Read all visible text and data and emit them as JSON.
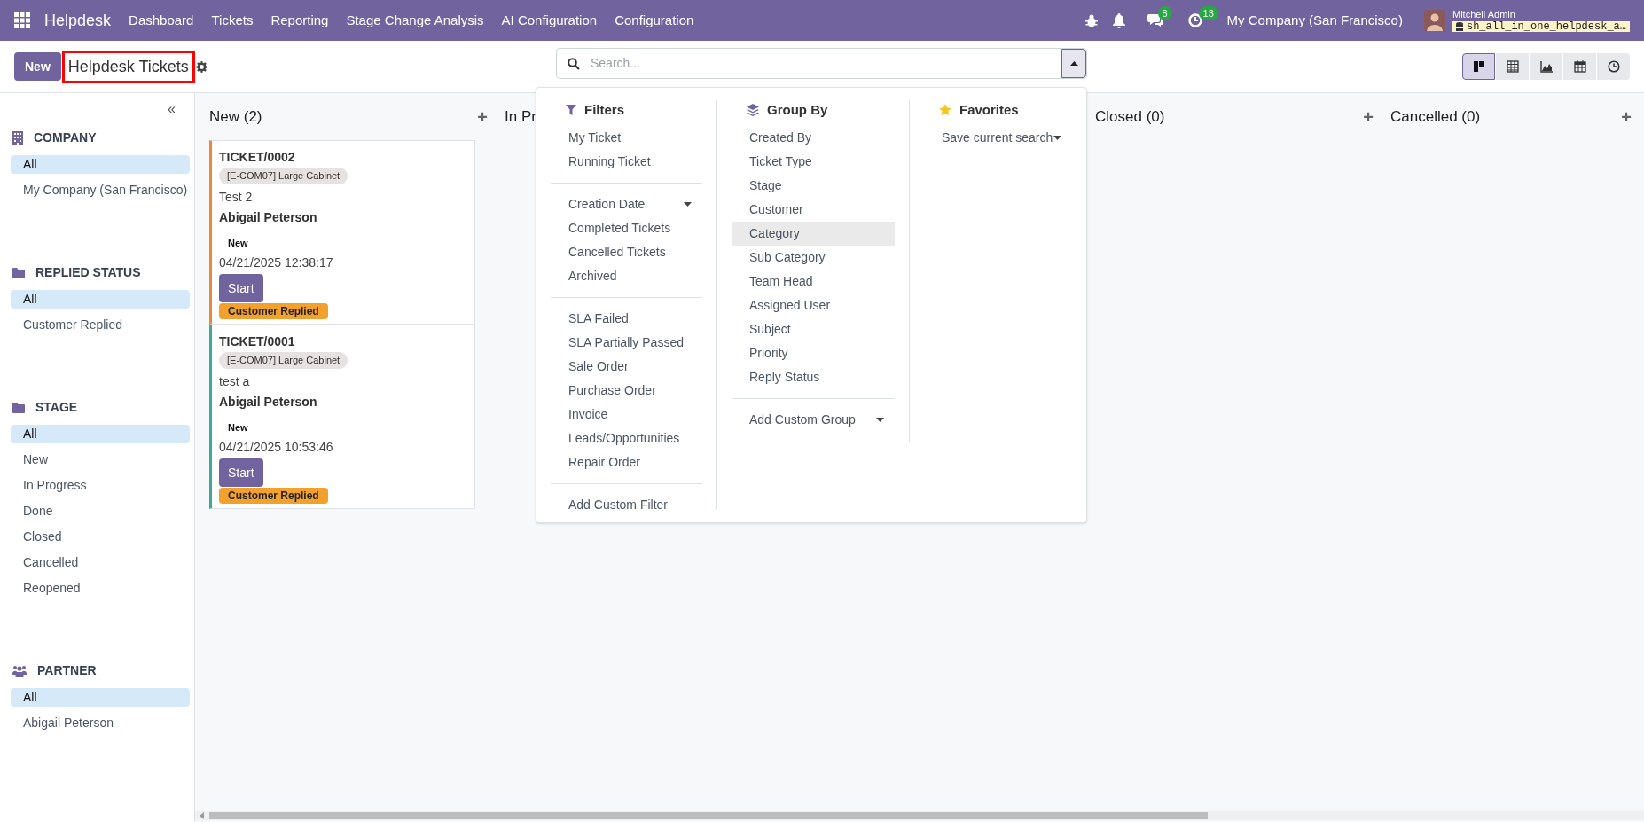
{
  "navbar": {
    "app_name": "Helpdesk",
    "menu": [
      "Dashboard",
      "Tickets",
      "Reporting",
      "Stage Change Analysis",
      "AI Configuration",
      "Configuration"
    ],
    "messages_count": "8",
    "activities_count": "13",
    "company": "My Company (San Francisco)",
    "user_name": "Mitchell Admin",
    "database": "sh_all_in_one_helpdesk_a…"
  },
  "control_panel": {
    "new_button": "New",
    "title": "Helpdesk Tickets",
    "title_highlighted": true,
    "search": {
      "placeholder": "Search..."
    },
    "views": [
      {
        "kind": "kanban",
        "selected": true
      },
      {
        "kind": "list",
        "selected": false
      },
      {
        "kind": "graph",
        "selected": false
      },
      {
        "kind": "calendar",
        "selected": false
      },
      {
        "kind": "activity",
        "selected": false
      }
    ]
  },
  "sidebar": {
    "collapse_icon": "«",
    "sections": [
      {
        "title": "COMPANY",
        "items": [
          {
            "label": "All",
            "selected": true
          },
          {
            "label": "My Company (San Francisco)",
            "selected": false
          }
        ]
      },
      {
        "title": "REPLIED STATUS",
        "items": [
          {
            "label": "All",
            "selected": true
          },
          {
            "label": "Customer Replied",
            "selected": false
          }
        ]
      },
      {
        "title": "STAGE",
        "items": [
          {
            "label": "All",
            "selected": true
          },
          {
            "label": "New",
            "selected": false
          },
          {
            "label": "In Progress",
            "selected": false
          },
          {
            "label": "Done",
            "selected": false
          },
          {
            "label": "Closed",
            "selected": false
          },
          {
            "label": "Cancelled",
            "selected": false
          },
          {
            "label": "Reopened",
            "selected": false
          }
        ]
      },
      {
        "title": "PARTNER",
        "items": [
          {
            "label": "All",
            "selected": true
          },
          {
            "label": "Abigail Peterson",
            "selected": false
          }
        ]
      }
    ]
  },
  "kanban": {
    "columns": [
      {
        "title": "New (2)",
        "add_icon": "+",
        "cards": [
          {
            "reference": "TICKET/0002",
            "product": "[E-COM07] Large Cabinet",
            "subject": "Test 2",
            "customer": "Abigail Peterson",
            "stage": "New",
            "date": "04/21/2025 12:38:17",
            "action": "Start",
            "status": "Customer Replied",
            "color": "#e9873a"
          },
          {
            "reference": "TICKET/0001",
            "product": "[E-COM07] Large Cabinet",
            "subject": "test a",
            "customer": "Abigail Peterson",
            "stage": "New",
            "date": "04/21/2025 10:53:46",
            "action": "Start",
            "status": "Customer Replied",
            "color": "#3fa89c"
          }
        ]
      },
      {
        "title": "In Pr"
      },
      {},
      {
        "title": "Closed (0)",
        "add_icon": "+"
      },
      {
        "title": "Cancelled (0)",
        "add_icon": "+"
      }
    ]
  },
  "search_panel": {
    "filters": {
      "title": "Filters",
      "groups": [
        [
          {
            "label": "My Ticket",
            "kind": "option"
          },
          {
            "label": "Running Ticket",
            "kind": "option"
          }
        ],
        [
          {
            "label": "Creation Date",
            "kind": "submenu"
          },
          {
            "label": "Completed Tickets",
            "kind": "option"
          },
          {
            "label": "Cancelled Tickets",
            "kind": "option"
          },
          {
            "label": "Archived",
            "kind": "option"
          }
        ],
        [
          {
            "label": "SLA Failed",
            "kind": "option"
          },
          {
            "label": "SLA Partially Passed",
            "kind": "option"
          },
          {
            "label": "Sale Order",
            "kind": "option"
          },
          {
            "label": "Purchase Order",
            "kind": "option"
          },
          {
            "label": "Invoice",
            "kind": "option"
          },
          {
            "label": "Leads/Opportunities",
            "kind": "option"
          },
          {
            "label": "Repair Order",
            "kind": "option"
          }
        ],
        [
          {
            "label": "Add Custom Filter",
            "kind": "option"
          }
        ]
      ]
    },
    "group_by": {
      "title": "Group By",
      "groups": [
        [
          {
            "label": "Created By",
            "kind": "option",
            "hovered": false
          },
          {
            "label": "Ticket Type",
            "kind": "option",
            "hovered": false
          },
          {
            "label": "Stage",
            "kind": "option",
            "hovered": false
          },
          {
            "label": "Customer",
            "kind": "option",
            "hovered": false
          },
          {
            "label": "Category",
            "kind": "option",
            "hovered": true
          },
          {
            "label": "Sub Category",
            "kind": "option",
            "hovered": false
          },
          {
            "label": "Team Head",
            "kind": "option",
            "hovered": false
          },
          {
            "label": "Assigned User",
            "kind": "option",
            "hovered": false
          },
          {
            "label": "Subject",
            "kind": "option",
            "hovered": false
          },
          {
            "label": "Priority",
            "kind": "option",
            "hovered": false
          },
          {
            "label": "Reply Status",
            "kind": "option",
            "hovered": false
          }
        ],
        [
          {
            "label": "Add Custom Group",
            "kind": "submenu",
            "hovered": false
          }
        ]
      ]
    },
    "favorites": {
      "title": "Favorites",
      "items": [
        {
          "label": "Save current search",
          "kind": "submenu"
        }
      ]
    }
  }
}
